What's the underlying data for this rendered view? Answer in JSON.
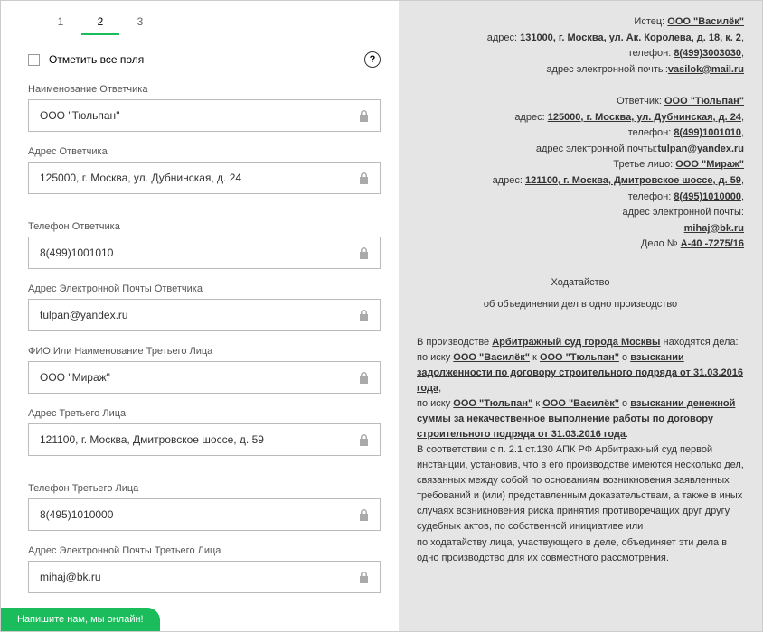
{
  "tabs": {
    "t1": "1",
    "t2": "2",
    "t3": "3"
  },
  "checkAll": "Отметить все поля",
  "help": "?",
  "fields": {
    "defendantName": {
      "label": "Наименование Ответчика",
      "value": "ООО \"Тюльпан\""
    },
    "defendantAddress": {
      "label": "Адрес Ответчика",
      "value": "125000, г. Москва, ул. Дубнинская, д. 24"
    },
    "defendantPhone": {
      "label": "Телефон Ответчика",
      "value": "8(499)1001010"
    },
    "defendantEmail": {
      "label": "Адрес Электронной Почты Ответчика",
      "value": "tulpan@yandex.ru"
    },
    "thirdName": {
      "label": "ФИО Или Наименование Третьего Лица",
      "value": "ООО \"Мираж\""
    },
    "thirdAddress": {
      "label": "Адрес Третьего Лица",
      "value": "121100, г. Москва, Дмитровское шоссе, д. 59"
    },
    "thirdPhone": {
      "label": "Телефон Третьего Лица",
      "value": "8(495)1010000"
    },
    "thirdEmail": {
      "label": "Адрес Электронной Почты Третьего Лица",
      "value": "mihaj@bk.ru"
    }
  },
  "chat": "Напишите нам, мы онлайн!",
  "doc": {
    "plaintiffLabel": "Истец: ",
    "plaintiff": "ООО \"Василёк\"",
    "addrLabel": "адрес: ",
    "plaintiffAddr": "131000, г. Москва, ул. Ак. Королева, д. 18, к. 2",
    "phoneLabel": "телефон: ",
    "plaintiffPhone": "8(499)3003030",
    "emailLabel": "адрес электронной почты:",
    "plaintiffEmail": "vasilok@mail.ru",
    "defendantLabel": "Ответчик: ",
    "defendant": "ООО \"Тюльпан\"",
    "defendantAddr": "125000, г. Москва, ул. Дубнинская, д. 24",
    "defendantPhone": "8(499)1001010",
    "defendantEmail": "tulpan@yandex.ru",
    "thirdLabel": "Третье лицо: ",
    "third": "ООО \"Мираж\"",
    "thirdAddr": "121100, г. Москва, Дмитровское шоссе, д. 59",
    "thirdPhone": "8(495)1010000",
    "thirdEmail": "mihaj@bk.ru",
    "caseLabel": "Дело № ",
    "caseNo": "А-40 -7275/16",
    "title": "Ходатайство",
    "subtitle": "об объединении дел в одно производство",
    "b1a": "В производстве ",
    "b1court": "Арбитражный суд города Москвы",
    "b1b": " находятся дела:",
    "b2a": "по иску ",
    "b2p1": "ООО \"Василёк\"",
    "b2k": " к ",
    "b2p2": "ООО \"Тюльпан\"",
    "b2o": " о ",
    "b2claim": "взыскании задолженности по договору строительного подряда от 31.03.2016 года",
    "b3a": "по иску ",
    "b3p1": "ООО \"Тюльпан\"",
    "b3k": " к ",
    "b3p2": "ООО \"Василёк\"",
    "b3o": " о ",
    "b3claim": "взыскании денежной суммы за некачественное выполнение работы по договору строительного подряда от 31.03.2016 года",
    "dot": ".",
    "comma": ",",
    "b4": "В соответствии с п. 2.1 ст.130 АПК РФ Арбитражный суд первой инстанции, установив, что в его производстве имеются несколько дел, связанных между собой по основаниям возникновения заявленных требований и (или) представленным доказательствам, а также в иных",
    "b5": "случаях возникновения риска принятия противоречащих друг другу судебных актов, по собственной инициативе или",
    "b6": "по ходатайству лица, участвующего в деле, объединяет эти дела в одно производство для их совместного рассмотрения."
  }
}
